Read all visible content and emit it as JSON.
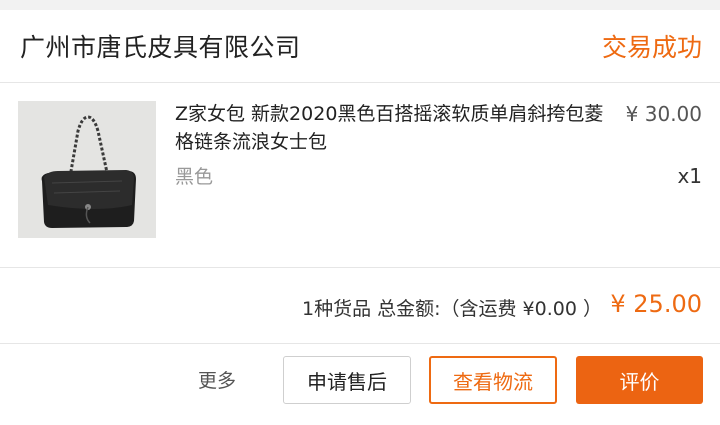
{
  "order": {
    "shop_name": "广州市唐氏皮具有限公司",
    "status": "交易成功"
  },
  "item": {
    "image_icon": "black-shoulder-bag-image",
    "title": "Z家女包 新款2020黑色百搭摇滚软质单肩斜挎包菱格链条流浪女士包",
    "price": "¥ 30.00",
    "variant": "黑色",
    "quantity": "x1"
  },
  "summary": {
    "text": "1种货品 总金额:（含运费 ¥0.00 ）",
    "total": "¥ 25.00"
  },
  "actions": {
    "more_label": "更多",
    "after_sales_label": "申请售后",
    "logistics_label": "查看物流",
    "review_label": "评价"
  },
  "colors": {
    "accent": "#ee6a12",
    "review_button": "#ec6412"
  }
}
